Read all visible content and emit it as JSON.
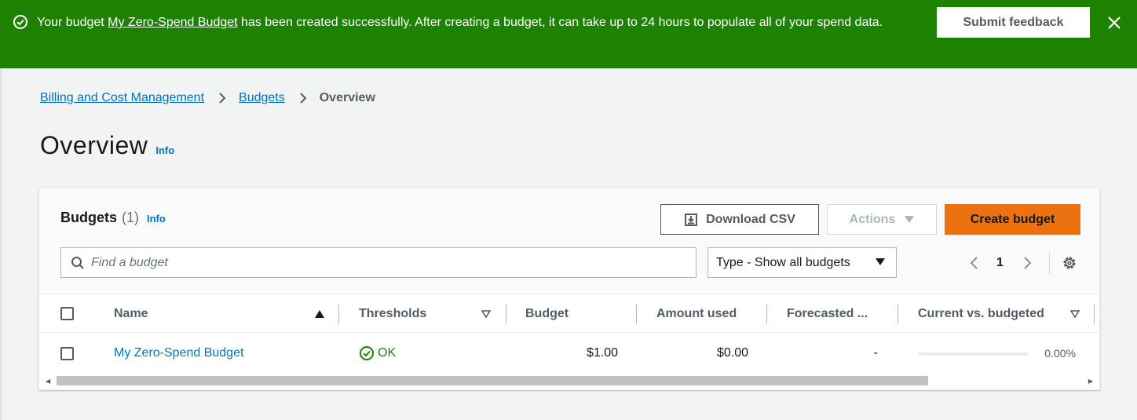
{
  "flash": {
    "prefix": "Your budget ",
    "budget_link": "My Zero-Spend Budget",
    "suffix": " has been created successfully. After creating a budget, it can take up to 24 hours to populate all of your spend data.",
    "feedback_label": "Submit feedback",
    "icons": {
      "status": "check-circle-icon",
      "close": "close-icon"
    }
  },
  "breadcrumb": {
    "items": [
      "Billing and Cost Management",
      "Budgets",
      "Overview"
    ]
  },
  "page": {
    "title": "Overview",
    "info": "Info"
  },
  "budgets_panel": {
    "title": "Budgets",
    "count": "(1)",
    "info": "Info",
    "download_label": "Download CSV",
    "actions_label": "Actions",
    "create_label": "Create budget",
    "search_placeholder": "Find a budget",
    "type_filter": "Type - Show all budgets",
    "page_number": "1",
    "columns": [
      "Name",
      "Thresholds",
      "Budget",
      "Amount used",
      "Forecasted ...",
      "Current vs. budgeted"
    ],
    "rows": [
      {
        "name": "My Zero-Spend Budget",
        "thresholds": "OK",
        "budget": "$1.00",
        "amount_used": "$0.00",
        "forecasted": "-",
        "current_vs_budgeted": "0.00%",
        "current_vs_budgeted_fraction": 0.0
      }
    ]
  },
  "colors": {
    "success_green": "#1d8102",
    "link_blue": "#0073bb",
    "primary_orange": "#ec7211"
  }
}
